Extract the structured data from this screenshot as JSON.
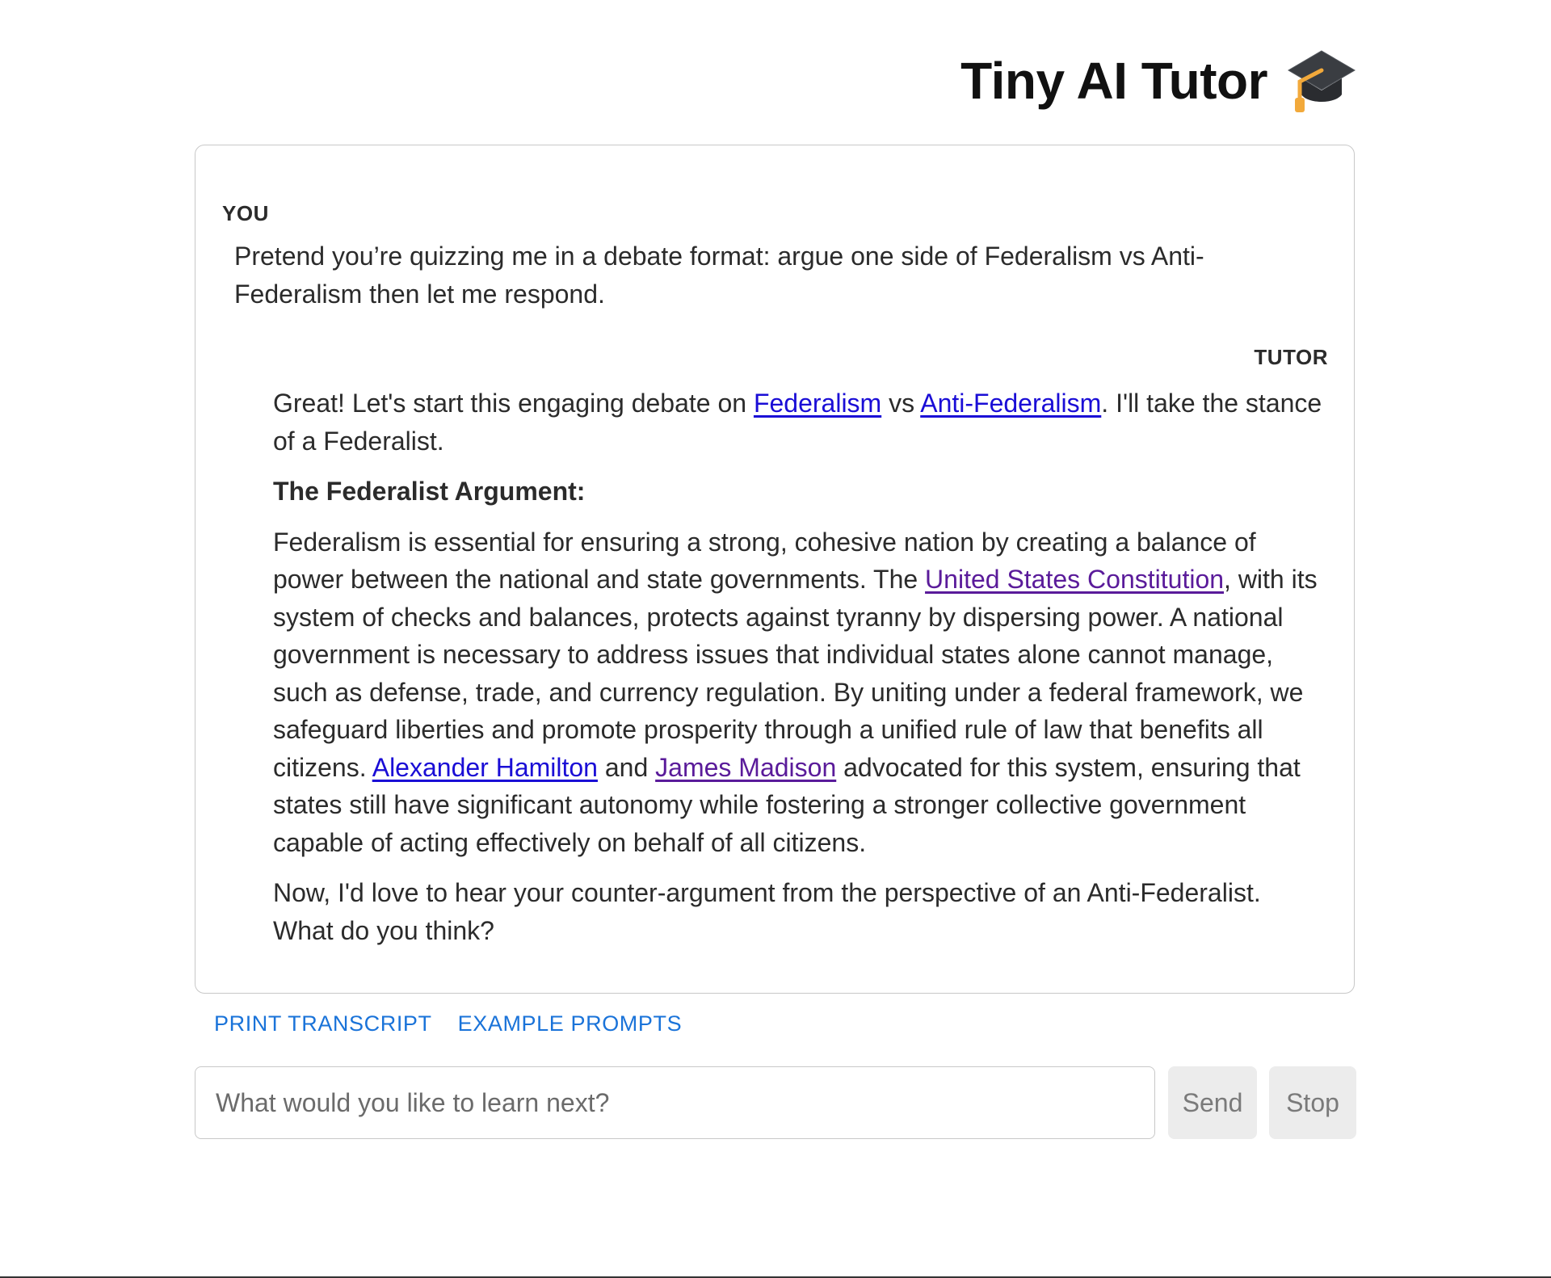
{
  "header": {
    "title": "Tiny AI Tutor",
    "icon": "graduation-cap-icon"
  },
  "transcript": {
    "user": {
      "label": "YOU",
      "message": "Pretend you’re quizzing me in a debate format: argue one side of Federalism vs Anti-Federalism then let me respond."
    },
    "tutor": {
      "label": "TUTOR",
      "p1_before": "Great! Let's start this engaging debate on ",
      "link_federalism": "Federalism",
      "p1_vs": " vs ",
      "link_antifederalism": "Anti-Federalism",
      "p1_after": ". I'll take the stance of a Federalist.",
      "heading": "The Federalist Argument:",
      "p2_before": "Federalism is essential for ensuring a strong, cohesive nation by creating a balance of power between the national and state governments. The ",
      "link_constitution": "United States Constitution",
      "p2_mid": ", with its system of checks and balances, protects against tyranny by dispersing power. A national government is necessary to address issues that individual states alone cannot manage, such as defense, trade, and currency regulation. By uniting under a federal framework, we safeguard liberties and promote prosperity through a unified rule of law that benefits all citizens. ",
      "link_hamilton": "Alexander Hamilton",
      "p2_and": " and ",
      "link_madison": "James Madison",
      "p2_after": " advocated for this system, ensuring that states still have significant autonomy while fostering a stronger collective government capable of acting effectively on behalf of all citizens.",
      "p3": "Now, I'd love to hear your counter-argument from the perspective of an Anti-Federalist. What do you think?"
    }
  },
  "actions": {
    "print_transcript": "PRINT TRANSCRIPT",
    "example_prompts": "EXAMPLE PROMPTS"
  },
  "composer": {
    "placeholder": "What would you like to learn next?",
    "value": "",
    "send_label": "Send",
    "stop_label": "Stop"
  },
  "colors": {
    "link": "#1a0dd6",
    "visited_link": "#5a1b9a",
    "action_link": "#1a73d9",
    "button_bg": "#ececec"
  }
}
